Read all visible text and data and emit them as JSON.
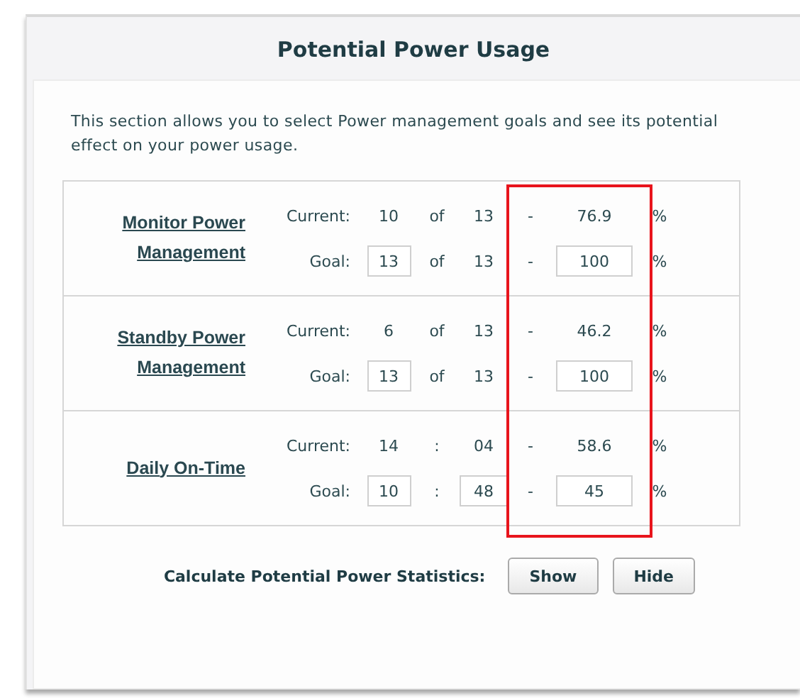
{
  "panel": {
    "title": "Potential Power Usage"
  },
  "description": "This section allows you to select Power management goals and see its potential effect on your power usage.",
  "rows": [
    {
      "kind": "count",
      "name": "Monitor Power Management",
      "current_label": "Current:",
      "current": [
        "10",
        "13"
      ],
      "current_sep": "of",
      "current_dash": "-",
      "current_percent": "76.9",
      "current_unit": "%",
      "goal_label": "Goal:",
      "goal": [
        "13",
        "13"
      ],
      "goal_sep": "of",
      "goal_dash": "-",
      "goal_percent": "100",
      "goal_unit": "%"
    },
    {
      "kind": "count",
      "name": "Standby Power Management",
      "current_label": "Current:",
      "current": [
        "6",
        "13"
      ],
      "current_sep": "of",
      "current_dash": "-",
      "current_percent": "46.2",
      "current_unit": "%",
      "goal_label": "Goal:",
      "goal": [
        "13",
        "13"
      ],
      "goal_sep": "of",
      "goal_dash": "-",
      "goal_percent": "100",
      "goal_unit": "%"
    },
    {
      "kind": "time",
      "name": "Daily On-Time",
      "current_label": "Current:",
      "current": [
        "14",
        "04"
      ],
      "current_sep": ":",
      "current_dash": "-",
      "current_percent": "58.6",
      "current_unit": "%",
      "goal_label": "Goal:",
      "goal": [
        "10",
        "48"
      ],
      "goal_sep": ":",
      "goal_dash": "-",
      "goal_percent": "45",
      "goal_unit": "%"
    }
  ],
  "calculate": {
    "label": "Calculate Potential Power Statistics:",
    "buttons": [
      "Show",
      "Hide"
    ]
  }
}
